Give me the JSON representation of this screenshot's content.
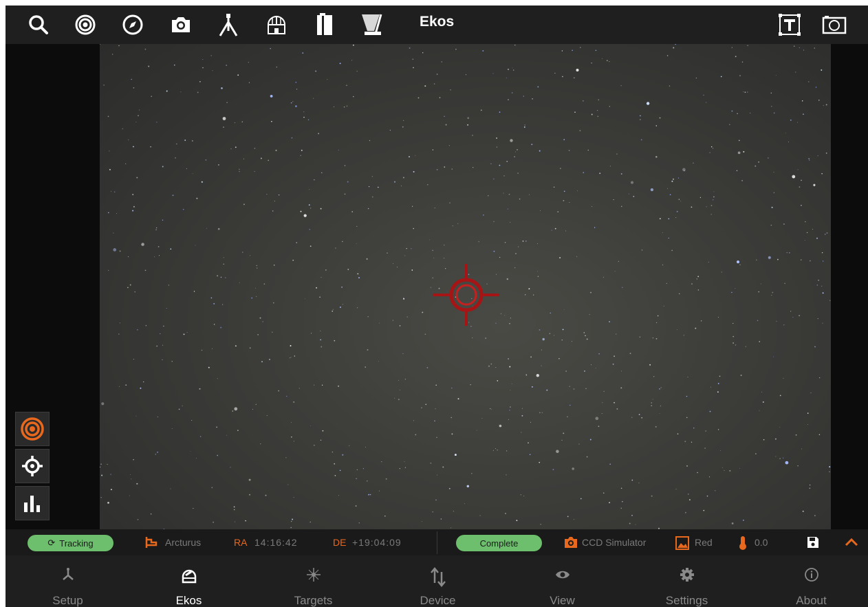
{
  "topbar": {
    "title": "Ekos",
    "icons": [
      "search-icon",
      "target-icon",
      "compass-icon",
      "camera-icon",
      "tripod-icon",
      "observatory-dome-icon",
      "filter-wheel-icon",
      "flat-panel-icon",
      "text-overlay-icon",
      "image-frame-icon"
    ]
  },
  "side_tools": [
    "target-icon",
    "crosshair-icon",
    "histogram-icon"
  ],
  "status": {
    "mount_state": "Tracking",
    "target_name": "Arcturus",
    "ra_label": "RA",
    "ra_value": "14:16:42",
    "de_label": "DE",
    "de_value": "+19:04:09",
    "capture_state": "Complete",
    "camera_name": "CCD Simulator",
    "filter_name": "Red",
    "temperature": "0.0"
  },
  "nav": {
    "items": [
      {
        "label": "Setup",
        "icon": "setup-icon"
      },
      {
        "label": "Ekos",
        "icon": "ekos-dome-icon"
      },
      {
        "label": "Targets",
        "icon": "star-icon"
      },
      {
        "label": "Device",
        "icon": "transfer-arrows-icon"
      },
      {
        "label": "View",
        "icon": "eye-icon"
      },
      {
        "label": "Settings",
        "icon": "gear-icon"
      },
      {
        "label": "About",
        "icon": "info-icon"
      }
    ],
    "active_index": 1
  },
  "colors": {
    "accent": "#e8681e",
    "status_green": "#6dbf6d",
    "crosshair": "#b01818"
  }
}
